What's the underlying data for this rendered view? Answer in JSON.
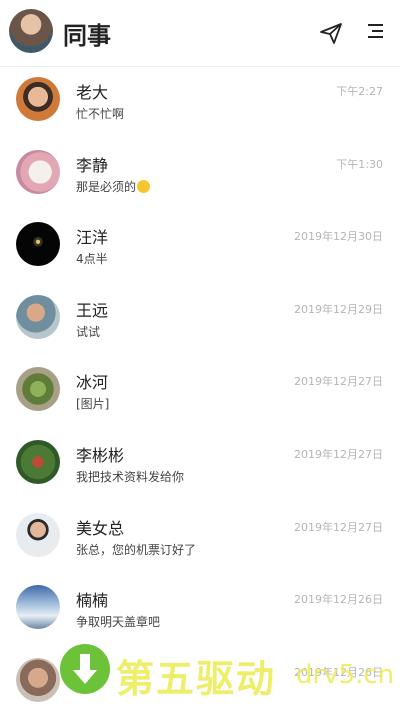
{
  "header": {
    "title": "同事"
  },
  "contacts": [
    {
      "name": "老大",
      "message": "忙不忙啊",
      "time": "下午2:27"
    },
    {
      "name": "李静",
      "message": "那是必须的",
      "time": "下午1:30"
    },
    {
      "name": "汪洋",
      "message": "4点半",
      "time": "2019年12月30日"
    },
    {
      "name": "王远",
      "message": "试试",
      "time": "2019年12月29日"
    },
    {
      "name": "冰河",
      "message": "[图片]",
      "time": "2019年12月27日"
    },
    {
      "name": "李彬彬",
      "message": "我把技术资料发给你",
      "time": "2019年12月27日"
    },
    {
      "name": "美女总",
      "message": "张总，您的机票订好了",
      "time": "2019年12月27日"
    },
    {
      "name": "楠楠",
      "message": "争取明天盖章吧",
      "time": "2019年12月26日"
    },
    {
      "name": "",
      "message": "",
      "time": "2019年12月26日"
    }
  ],
  "watermark": {
    "cn": "第五驱动",
    "en": "drv5.cn"
  },
  "colors": {
    "time": "#b5b5b5",
    "divider": "#ececec"
  }
}
